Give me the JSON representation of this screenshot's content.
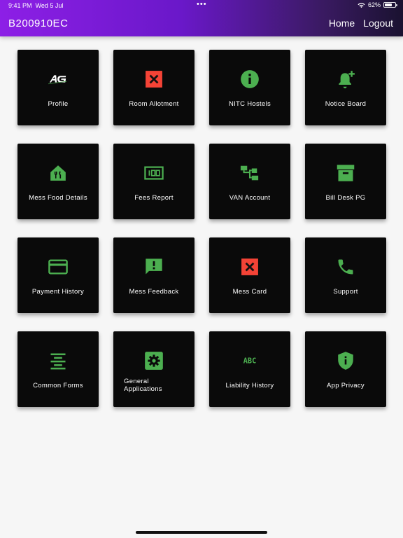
{
  "status_bar": {
    "time": "9:41 PM",
    "date": "Wed 5 Jul",
    "dots": "•••",
    "battery": "62%"
  },
  "header": {
    "title": "B200910EC",
    "nav": [
      "Home",
      "Logout"
    ]
  },
  "colors": {
    "accent_green": "#4caf50",
    "accent_red": "#f44336",
    "tile_bg": "#0a0a0a",
    "header_start": "#8d1fe6",
    "header_end": "#1a1230"
  },
  "tiles": [
    {
      "label": "Profile",
      "icon": "logo-ag-icon"
    },
    {
      "label": "Room Allotment",
      "icon": "close-box-icon"
    },
    {
      "label": "NITC Hostels",
      "icon": "info-icon"
    },
    {
      "label": "Notice Board",
      "icon": "bell-plus-icon"
    },
    {
      "label": "Mess Food Details",
      "icon": "food-home-icon"
    },
    {
      "label": "Fees Report",
      "icon": "hundred-icon"
    },
    {
      "label": "VAN Account",
      "icon": "account-tree-icon"
    },
    {
      "label": "Bill Desk PG",
      "icon": "archive-icon"
    },
    {
      "label": "Payment History",
      "icon": "credit-card-icon"
    },
    {
      "label": "Mess Feedback",
      "icon": "feedback-icon"
    },
    {
      "label": "Mess Card",
      "icon": "close-box-icon"
    },
    {
      "label": "Support",
      "icon": "phone-icon"
    },
    {
      "label": "Common Forms",
      "icon": "align-center-icon"
    },
    {
      "label": "General Applications",
      "icon": "settings-box-icon"
    },
    {
      "label": "Liability History",
      "icon": "abc-icon"
    },
    {
      "label": "App Privacy",
      "icon": "shield-info-icon"
    }
  ]
}
